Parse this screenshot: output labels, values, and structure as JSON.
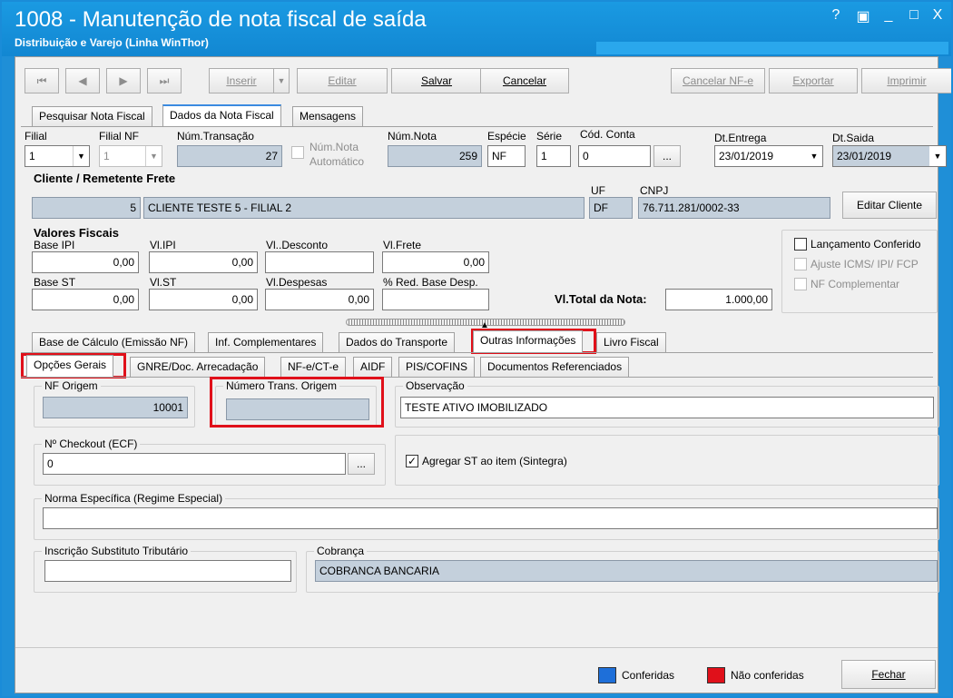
{
  "window": {
    "title": "1008 - Manutenção de nota fiscal de saída",
    "subtitle": "Distribuição e Varejo (Linha WinThor)",
    "controls": [
      "?",
      "▣",
      "_",
      "□",
      "X"
    ]
  },
  "toolbar": {
    "first": "⏮",
    "prev": "◀",
    "next": "▶",
    "last": "⏭",
    "insert": "Inserir",
    "insert_dropdown": "▼",
    "edit": "Editar",
    "save": "Salvar",
    "cancel": "Cancelar",
    "cancel_nfe": "Cancelar NF-e",
    "export": "Exportar",
    "print": "Imprimir"
  },
  "main_tabs": [
    "Pesquisar Nota Fiscal",
    "Dados da Nota Fiscal",
    "Mensagens"
  ],
  "header": {
    "filial_label": "Filial",
    "filial_value": "1",
    "filial_nf_label": "Filial NF",
    "filial_nf_value": "1",
    "num_transacao_label": "Núm.Transação",
    "num_transacao_value": "27",
    "num_nota_auto_label_1": "Núm.Nota",
    "num_nota_auto_label_2": "Automático",
    "num_nota_label": "Núm.Nota",
    "num_nota_value": "259",
    "especie_label": "Espécie",
    "especie_value": "NF",
    "serie_label": "Série",
    "serie_value": "1",
    "cod_conta_label": "Cód. Conta",
    "cod_conta_value": "0",
    "ellipsis": "...",
    "dt_entrega_label": "Dt.Entrega",
    "dt_entrega_value": "23/01/2019",
    "dt_saida_label": "Dt.Saida",
    "dt_saida_value": "23/01/2019"
  },
  "cliente": {
    "section_title": "Cliente / Remetente Frete",
    "code": "5",
    "name": "CLIENTE TESTE 5  - FILIAL 2",
    "uf_label": "UF",
    "uf_value": "DF",
    "cnpj_label": "CNPJ",
    "cnpj_value": "76.711.281/0002-33",
    "edit_button": "Editar Cliente"
  },
  "valores": {
    "section_title": "Valores Fiscais",
    "base_ipi_label": "Base IPI",
    "base_ipi_value": "0,00",
    "vl_ipi_label": "Vl.IPI",
    "vl_ipi_value": "0,00",
    "vl_desconto_label": "Vl..Desconto",
    "vl_desconto_value": "",
    "vl_frete_label": "Vl.Frete",
    "vl_frete_value": "0,00",
    "base_st_label": "Base ST",
    "base_st_value": "0,00",
    "vl_st_label": "Vl.ST",
    "vl_st_value": "0,00",
    "vl_despesas_label": "Vl.Despesas",
    "vl_despesas_value": "0,00",
    "red_base_label": "% Red. Base Desp.",
    "red_base_value": "",
    "total_label": "Vl.Total da Nota:",
    "total_value": "1.000,00"
  },
  "checks": {
    "lancamento": "Lançamento Conferido",
    "ajuste": "Ajuste ICMS/ IPI/ FCP",
    "nf_complementar": "NF Complementar"
  },
  "sub_tabs": [
    "Base de Cálculo (Emissão NF)",
    "Inf. Complementares",
    "Dados do Transporte",
    "Outras Informações",
    "Livro Fiscal"
  ],
  "inner_tabs": [
    "Opções Gerais",
    "GNRE/Doc. Arrecadação",
    "NF-e/CT-e",
    "AIDF",
    "PIS/COFINS",
    "Documentos Referenciados"
  ],
  "opcoes": {
    "nf_origem_label": "NF Origem",
    "nf_origem_value": "10001",
    "num_trans_origem_label": "Número Trans. Origem",
    "num_trans_origem_value": "",
    "observacao_label": "Observação",
    "observacao_value": "TESTE ATIVO IMOBILIZADO",
    "checkout_label": "Nº Checkout (ECF)",
    "checkout_value": "0",
    "ellipsis": "...",
    "agregar_st_label": "Agregar ST ao item (Sintegra)",
    "agregar_st_checked": "✓",
    "norma_label": "Norma Específica (Regime Especial)",
    "norma_value": "",
    "inscricao_label": "Inscrição Substituto Tributário",
    "inscricao_value": "",
    "cobranca_label": "Cobrança",
    "cobranca_value": "COBRANCA BANCARIA"
  },
  "footer": {
    "conferidas_label": "Conferidas",
    "conferidas_color": "#1e6fd9",
    "nao_conferidas_label": "Não conferidas",
    "nao_conferidas_color": "#e0101a",
    "close_button": "Fechar"
  }
}
